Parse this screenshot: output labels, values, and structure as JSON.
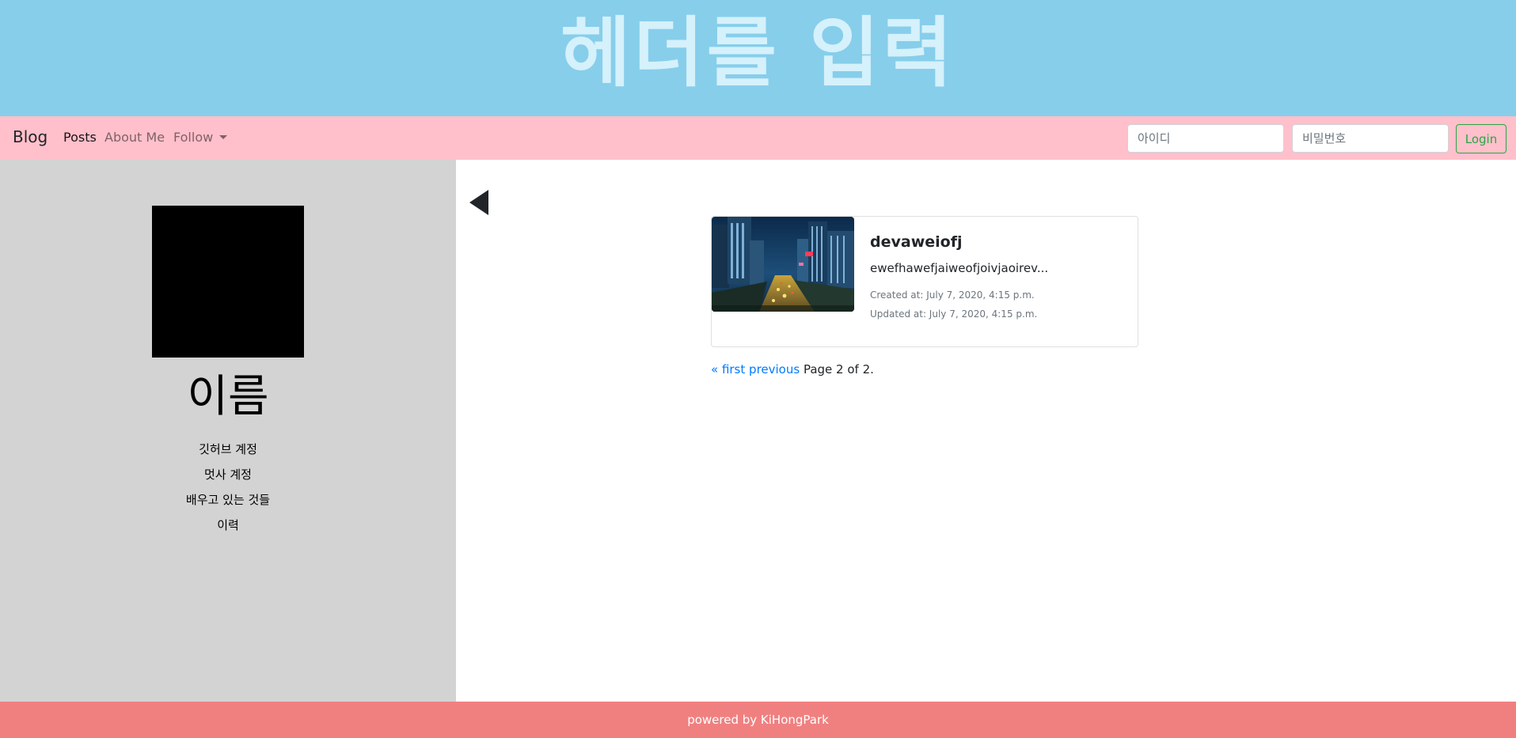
{
  "header": {
    "title": "헤더를 입력"
  },
  "navbar": {
    "brand": "Blog",
    "links": [
      {
        "label": "Posts",
        "active": true
      },
      {
        "label": "About Me",
        "active": false
      },
      {
        "label": "Follow",
        "dropdown": true
      }
    ],
    "login": {
      "id_placeholder": "아이디",
      "pw_placeholder": "비밀번호",
      "button_label": "Login"
    }
  },
  "sidebar": {
    "name": "이름",
    "links": [
      "깃허브 계정",
      "멋사 계정",
      "배우고 있는 것들",
      "이력"
    ]
  },
  "main": {
    "back_icon": "left-triangle-icon",
    "posts": [
      {
        "title": "devaweiofj",
        "excerpt": "ewefhawefjaiweofjoivjaoirev...",
        "created": "Created at: July 7, 2020, 4:15 p.m.",
        "updated": "Updated at: July 7, 2020, 4:15 p.m."
      }
    ],
    "pagination": {
      "first": "« first",
      "previous": "previous",
      "status": "Page 2 of 2."
    }
  },
  "footer": {
    "text": "powered by KiHongPark"
  },
  "colors": {
    "header_bg": "#87ceeb",
    "navbar_bg": "#ffc0cb",
    "sidebar_bg": "#d3d3d3",
    "footer_bg": "#f08080",
    "link": "#007bff",
    "login_green": "#28a745"
  }
}
